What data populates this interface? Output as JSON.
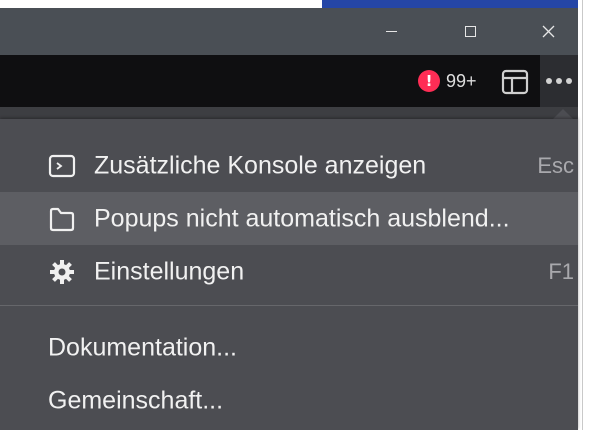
{
  "titlebar": {
    "minimize_icon": "minimize-icon",
    "maximize_icon": "maximize-icon",
    "close_icon": "close-icon"
  },
  "toolbar": {
    "alert_count": "99+",
    "alert_symbol": "!",
    "alert_color": "#ff2d55"
  },
  "menu": {
    "items": [
      {
        "label": "Zusätzliche Konsole anzeigen",
        "shortcut": "Esc",
        "icon": "console-icon"
      },
      {
        "label": "Popups nicht automatisch ausblend...",
        "shortcut": "",
        "icon": "folder-icon",
        "highlighted": true
      },
      {
        "label": "Einstellungen",
        "shortcut": "F1",
        "icon": "gear-icon"
      },
      {
        "label": "Dokumentation...",
        "shortcut": "",
        "icon": ""
      },
      {
        "label": "Gemeinschaft...",
        "shortcut": "",
        "icon": ""
      }
    ]
  }
}
